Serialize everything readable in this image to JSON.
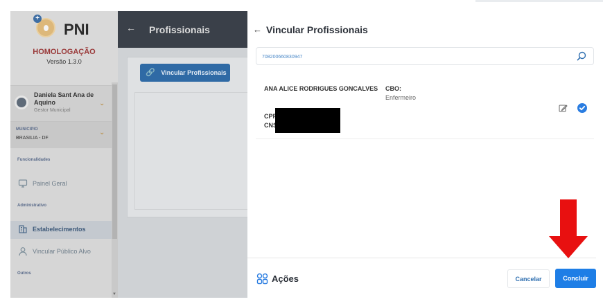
{
  "sidebar": {
    "logo_badge": "+",
    "logo_text": "PNI",
    "environment": "HOMOLOGAÇÃO",
    "version": "Versão 1.3.0",
    "user": {
      "name": "Daniela Sant Ana de Aquino",
      "role": "Gestor Municipal"
    },
    "municipio": {
      "label": "MUNICIPIO",
      "value": "BRASILIA - DF"
    },
    "sections": {
      "funcionalidades": "Funcionalidades",
      "administrativo": "Administrativo",
      "outros": "Outros"
    },
    "items": [
      {
        "label": "Painel Geral",
        "icon": "monitor-icon"
      },
      {
        "label": "Estabelecimentos",
        "icon": "building-icon",
        "active": true
      },
      {
        "label": "Vincular Público Alvo",
        "icon": "user-icon"
      }
    ]
  },
  "main": {
    "title": "Profissionais",
    "vincular_button": "Vincular Profissionais"
  },
  "drawer": {
    "title": "Vincular Profissionais",
    "search": {
      "value": "708200660830947"
    },
    "result": {
      "name": "ANA ALICE RODRIGUES GONCALVES",
      "cbo_label": "CBO:",
      "cbo_value": "Enfermeiro",
      "cpf_label": "CPF",
      "cns_label": "CNS"
    },
    "footer": {
      "actions_label": "Ações",
      "cancel_label": "Cancelar",
      "concluir_label": "Concluir"
    }
  },
  "colors": {
    "primary": "#1e7ee6",
    "annotation_arrow": "#e81010",
    "topbar": "#3a4049"
  }
}
